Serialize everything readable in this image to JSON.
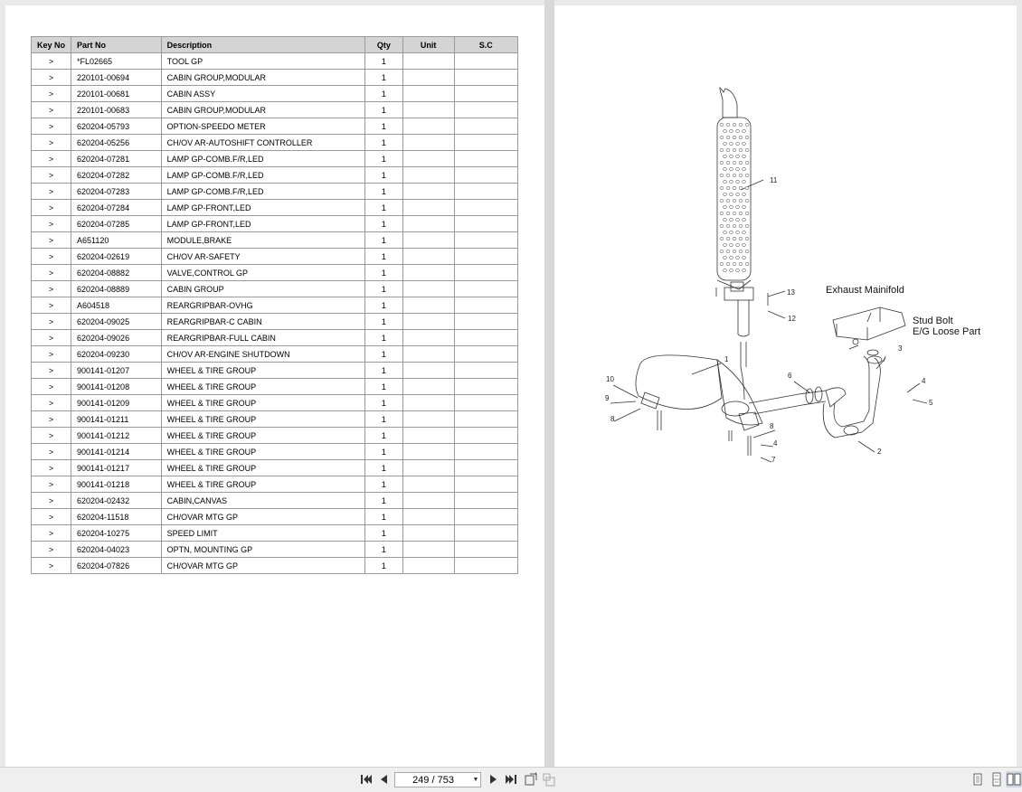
{
  "table": {
    "headers": {
      "key": "Key No",
      "part": "Part No",
      "desc": "Description",
      "qty": "Qty",
      "unit": "Unit",
      "sc": "S.C"
    },
    "rows": [
      {
        "key": ">",
        "part": "*FL02665",
        "desc": "TOOL GP",
        "qty": "1"
      },
      {
        "key": ">",
        "part": "220101-00694",
        "desc": "CABIN GROUP,MODULAR",
        "qty": "1"
      },
      {
        "key": ">",
        "part": "220101-00681",
        "desc": "CABIN ASSY",
        "qty": "1"
      },
      {
        "key": ">",
        "part": "220101-00683",
        "desc": "CABIN GROUP,MODULAR",
        "qty": "1"
      },
      {
        "key": ">",
        "part": "620204-05793",
        "desc": "OPTION-SPEEDO METER",
        "qty": "1"
      },
      {
        "key": ">",
        "part": "620204-05256",
        "desc": "CH/OV AR-AUTOSHIFT CONTROLLER",
        "qty": "1"
      },
      {
        "key": ">",
        "part": "620204-07281",
        "desc": "LAMP GP-COMB.F/R,LED",
        "qty": "1"
      },
      {
        "key": ">",
        "part": "620204-07282",
        "desc": "LAMP GP-COMB.F/R,LED",
        "qty": "1"
      },
      {
        "key": ">",
        "part": "620204-07283",
        "desc": "LAMP GP-COMB.F/R,LED",
        "qty": "1"
      },
      {
        "key": ">",
        "part": "620204-07284",
        "desc": "LAMP GP-FRONT,LED",
        "qty": "1"
      },
      {
        "key": ">",
        "part": "620204-07285",
        "desc": "LAMP GP-FRONT,LED",
        "qty": "1"
      },
      {
        "key": ">",
        "part": "A651120",
        "desc": "MODULE,BRAKE",
        "qty": "1"
      },
      {
        "key": ">",
        "part": "620204-02619",
        "desc": "CH/OV AR-SAFETY",
        "qty": "1"
      },
      {
        "key": ">",
        "part": "620204-08882",
        "desc": "VALVE,CONTROL GP",
        "qty": "1"
      },
      {
        "key": ">",
        "part": "620204-08889",
        "desc": "CABIN GROUP",
        "qty": "1"
      },
      {
        "key": ">",
        "part": "A604518",
        "desc": "REARGRIPBAR-OVHG",
        "qty": "1"
      },
      {
        "key": ">",
        "part": "620204-09025",
        "desc": "REARGRIPBAR-C CABIN",
        "qty": "1"
      },
      {
        "key": ">",
        "part": "620204-09026",
        "desc": "REARGRIPBAR-FULL CABIN",
        "qty": "1"
      },
      {
        "key": ">",
        "part": "620204-09230",
        "desc": "CH/OV AR-ENGINE SHUTDOWN",
        "qty": "1"
      },
      {
        "key": ">",
        "part": "900141-01207",
        "desc": "WHEEL & TIRE GROUP",
        "qty": "1"
      },
      {
        "key": ">",
        "part": "900141-01208",
        "desc": "WHEEL & TIRE GROUP",
        "qty": "1"
      },
      {
        "key": ">",
        "part": "900141-01209",
        "desc": "WHEEL & TIRE GROUP",
        "qty": "1"
      },
      {
        "key": ">",
        "part": "900141-01211",
        "desc": "WHEEL & TIRE GROUP",
        "qty": "1"
      },
      {
        "key": ">",
        "part": "900141-01212",
        "desc": "WHEEL & TIRE GROUP",
        "qty": "1"
      },
      {
        "key": ">",
        "part": "900141-01214",
        "desc": "WHEEL & TIRE GROUP",
        "qty": "1"
      },
      {
        "key": ">",
        "part": "900141-01217",
        "desc": "WHEEL & TIRE GROUP",
        "qty": "1"
      },
      {
        "key": ">",
        "part": "900141-01218",
        "desc": "WHEEL & TIRE GROUP",
        "qty": "1"
      },
      {
        "key": ">",
        "part": "620204-02432",
        "desc": "CABIN,CANVAS",
        "qty": "1"
      },
      {
        "key": ">",
        "part": "620204-11518",
        "desc": "CH/OVAR MTG GP",
        "qty": "1"
      },
      {
        "key": ">",
        "part": "620204-10275",
        "desc": "SPEED LIMIT",
        "qty": "1"
      },
      {
        "key": ">",
        "part": "620204-04023",
        "desc": "OPTN, MOUNTING GP",
        "qty": "1"
      },
      {
        "key": ">",
        "part": "620204-07826",
        "desc": "CH/OVAR MTG GP",
        "qty": "1"
      }
    ]
  },
  "diagram": {
    "callouts": {
      "c1": "1",
      "c2": "2",
      "c3": "3",
      "c4a": "4",
      "c4b": "4",
      "c5": "5",
      "c6": "6",
      "c7": "7",
      "c8a": "8",
      "c8b": "8",
      "c9": "9",
      "c10": "10",
      "c11": "11",
      "c12": "12",
      "c13": "13"
    },
    "labels": {
      "exhaust_manifold": "Exhaust Mainifold",
      "stud_bolt": "Stud Bolt",
      "eg_loose_part": "E/G Loose Part"
    }
  },
  "toolbar": {
    "page_indicator": "249 / 753",
    "icons": {
      "first": "first-page-icon",
      "prev": "prev-page-icon",
      "next": "next-page-icon",
      "last": "last-page-icon",
      "rotate_cw": "rotate-icon",
      "rotate_ccw": "rotate-ccw-icon",
      "single": "single-page-view-icon",
      "continuous": "continuous-view-icon",
      "two_page": "two-page-view-icon"
    }
  }
}
